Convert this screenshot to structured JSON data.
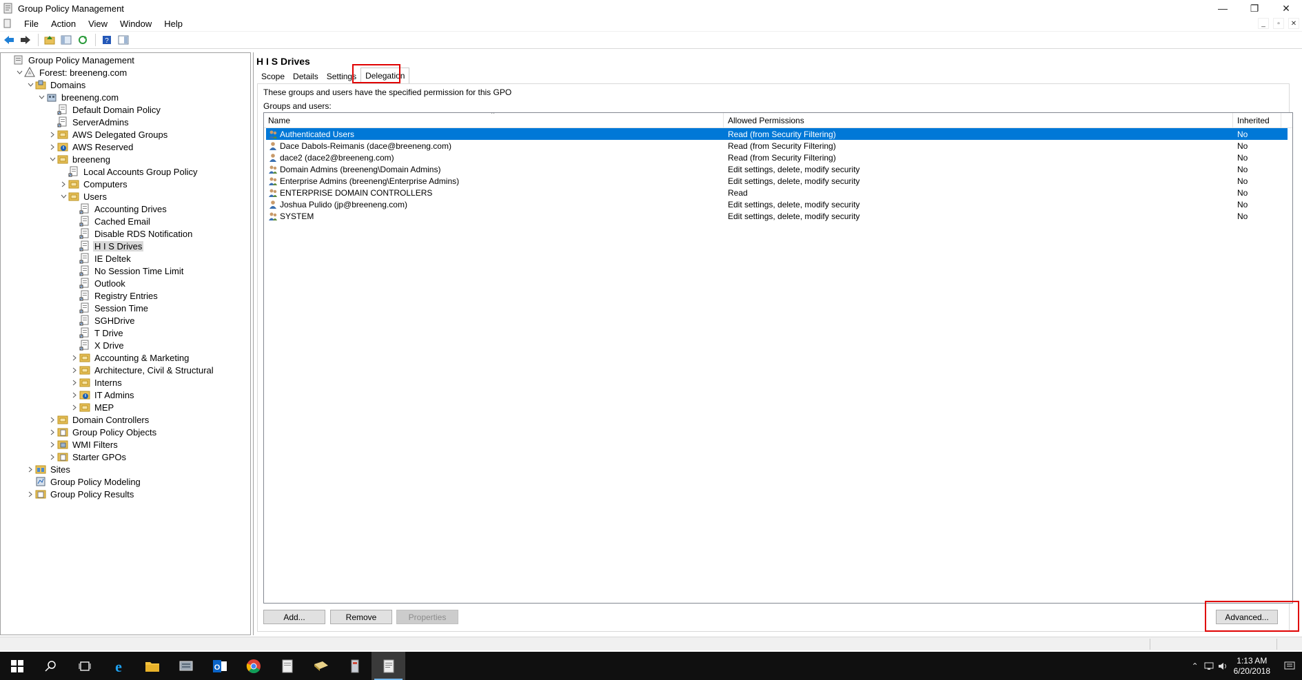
{
  "window": {
    "title": "Group Policy Management",
    "minimize": "—",
    "restore": "❐",
    "close": "✕"
  },
  "menu": [
    "File",
    "Action",
    "View",
    "Window",
    "Help"
  ],
  "tree": [
    {
      "label": "Group Policy Management",
      "level": 0,
      "expander": "",
      "icon": "gpm-icon"
    },
    {
      "label": "Forest: breeneng.com",
      "level": 1,
      "expander": "v",
      "icon": "forest-icon"
    },
    {
      "label": "Domains",
      "level": 2,
      "expander": "v",
      "icon": "domains-icon"
    },
    {
      "label": "breeneng.com",
      "level": 3,
      "expander": "v",
      "icon": "domain-icon"
    },
    {
      "label": "Default Domain Policy",
      "level": 4,
      "expander": "",
      "icon": "gpo-link-icon"
    },
    {
      "label": "ServerAdmins",
      "level": 4,
      "expander": "",
      "icon": "gpo-link-icon"
    },
    {
      "label": "AWS Delegated Groups",
      "level": 4,
      "expander": ">",
      "icon": "ou-icon"
    },
    {
      "label": "AWS Reserved",
      "level": 4,
      "expander": ">",
      "icon": "ou-blocked-icon"
    },
    {
      "label": "breeneng",
      "level": 4,
      "expander": "v",
      "icon": "ou-icon"
    },
    {
      "label": "Local Accounts Group Policy",
      "level": 5,
      "expander": "",
      "icon": "gpo-link-icon"
    },
    {
      "label": "Computers",
      "level": 5,
      "expander": ">",
      "icon": "ou-icon"
    },
    {
      "label": "Users",
      "level": 5,
      "expander": "v",
      "icon": "ou-icon"
    },
    {
      "label": "Accounting Drives",
      "level": 6,
      "expander": "",
      "icon": "gpo-link-icon"
    },
    {
      "label": "Cached Email",
      "level": 6,
      "expander": "",
      "icon": "gpo-link-icon"
    },
    {
      "label": "Disable RDS Notification",
      "level": 6,
      "expander": "",
      "icon": "gpo-link-icon"
    },
    {
      "label": "H I S Drives",
      "level": 6,
      "expander": "",
      "icon": "gpo-link-icon",
      "selected": true
    },
    {
      "label": "IE Deltek",
      "level": 6,
      "expander": "",
      "icon": "gpo-link-icon"
    },
    {
      "label": "No Session Time Limit",
      "level": 6,
      "expander": "",
      "icon": "gpo-link-icon"
    },
    {
      "label": "Outlook",
      "level": 6,
      "expander": "",
      "icon": "gpo-link-icon"
    },
    {
      "label": "Registry Entries",
      "level": 6,
      "expander": "",
      "icon": "gpo-link-icon"
    },
    {
      "label": "Session Time",
      "level": 6,
      "expander": "",
      "icon": "gpo-link-icon"
    },
    {
      "label": "SGHDrive",
      "level": 6,
      "expander": "",
      "icon": "gpo-link-icon"
    },
    {
      "label": "T Drive",
      "level": 6,
      "expander": "",
      "icon": "gpo-link-icon"
    },
    {
      "label": "X Drive",
      "level": 6,
      "expander": "",
      "icon": "gpo-link-icon"
    },
    {
      "label": "Accounting & Marketing",
      "level": 6,
      "expander": ">",
      "icon": "ou-icon"
    },
    {
      "label": "Architecture, Civil & Structural",
      "level": 6,
      "expander": ">",
      "icon": "ou-icon"
    },
    {
      "label": "Interns",
      "level": 6,
      "expander": ">",
      "icon": "ou-icon"
    },
    {
      "label": "IT Admins",
      "level": 6,
      "expander": ">",
      "icon": "ou-blocked-icon"
    },
    {
      "label": "MEP",
      "level": 6,
      "expander": ">",
      "icon": "ou-icon"
    },
    {
      "label": "Domain Controllers",
      "level": 4,
      "expander": ">",
      "icon": "ou-icon"
    },
    {
      "label": "Group Policy Objects",
      "level": 4,
      "expander": ">",
      "icon": "gpo-folder-icon"
    },
    {
      "label": "WMI Filters",
      "level": 4,
      "expander": ">",
      "icon": "wmi-folder-icon"
    },
    {
      "label": "Starter GPOs",
      "level": 4,
      "expander": ">",
      "icon": "gpo-folder-icon"
    },
    {
      "label": "Sites",
      "level": 2,
      "expander": ">",
      "icon": "sites-icon"
    },
    {
      "label": "Group Policy Modeling",
      "level": 2,
      "expander": "",
      "icon": "modeling-icon"
    },
    {
      "label": "Group Policy Results",
      "level": 2,
      "expander": ">",
      "icon": "results-icon"
    }
  ],
  "gpo": {
    "title": "H I S Drives",
    "tabs": [
      "Scope",
      "Details",
      "Settings",
      "Delegation"
    ],
    "active_tab": "Delegation",
    "description": "These groups and users have the specified permission for this GPO",
    "groups_label": "Groups and users:",
    "columns": {
      "name": "Name",
      "permissions": "Allowed Permissions",
      "inherited": "Inherited"
    },
    "sort_indicator": "^",
    "rows": [
      {
        "name": "Authenticated Users",
        "permissions": "Read (from Security Filtering)",
        "inherited": "No",
        "icon": "group-icon",
        "selected": true
      },
      {
        "name": "Dace Dabols-Reimanis (dace@breeneng.com)",
        "permissions": "Read (from Security Filtering)",
        "inherited": "No",
        "icon": "user-icon"
      },
      {
        "name": "dace2 (dace2@breeneng.com)",
        "permissions": "Read (from Security Filtering)",
        "inherited": "No",
        "icon": "user-icon"
      },
      {
        "name": "Domain Admins (breeneng\\Domain Admins)",
        "permissions": "Edit settings, delete, modify security",
        "inherited": "No",
        "icon": "group-icon"
      },
      {
        "name": "Enterprise Admins (breeneng\\Enterprise Admins)",
        "permissions": "Edit settings, delete, modify security",
        "inherited": "No",
        "icon": "group-icon"
      },
      {
        "name": "ENTERPRISE DOMAIN CONTROLLERS",
        "permissions": "Read",
        "inherited": "No",
        "icon": "group-icon"
      },
      {
        "name": "Joshua Pulido (jp@breeneng.com)",
        "permissions": "Edit settings, delete, modify security",
        "inherited": "No",
        "icon": "user-icon"
      },
      {
        "name": "SYSTEM",
        "permissions": "Edit settings, delete, modify security",
        "inherited": "No",
        "icon": "group-icon"
      }
    ],
    "buttons": {
      "add": "Add...",
      "remove": "Remove",
      "properties": "Properties",
      "advanced": "Advanced..."
    }
  },
  "taskbar": {
    "time": "1:13 AM",
    "date": "6/20/2018"
  },
  "colors": {
    "selection": "#0078d7",
    "highlight_box": "#e00000",
    "taskbar": "#101010"
  }
}
